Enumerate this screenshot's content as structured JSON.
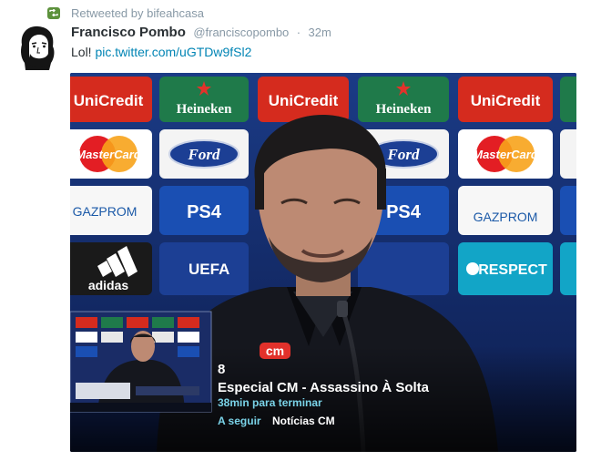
{
  "retweet": {
    "text": "Retweeted by bifeahcasa",
    "icon": "retweet-icon"
  },
  "tweet": {
    "author_name": "Francisco Pombo",
    "author_handle": "@franciscopombo",
    "separator": "·",
    "time": "32m",
    "text_prefix": "Lol!",
    "link": "pic.twitter.com/uGTDw9fSl2"
  },
  "media": {
    "sponsors": {
      "unicredit": "UniCredit",
      "heineken": "Heineken",
      "ford": "Ford",
      "mastercard": "MasterCard",
      "ps4": "PS4",
      "gazprom": "GAZPROM",
      "adidas": "adidas",
      "uefa": "UEFA",
      "respect": "RESPECT"
    },
    "tv_overlay": {
      "channel_logo": "cm",
      "channel_number": "8",
      "program_title": "Especial CM - Assassino À Solta",
      "remaining": "38min para terminar",
      "next_label": "A seguir",
      "next_program": "Notícias CM"
    }
  },
  "colors": {
    "retweet_green": "#5c913b",
    "link_blue": "#0084b4",
    "backdrop_navy": "#14285f",
    "unicredit_red": "#d52b1e",
    "heineken_green": "#1f7a4a",
    "ford_blue": "#1c3f94",
    "overlay_text": "#ffffff",
    "overlay_accent": "#7ad3e8"
  }
}
